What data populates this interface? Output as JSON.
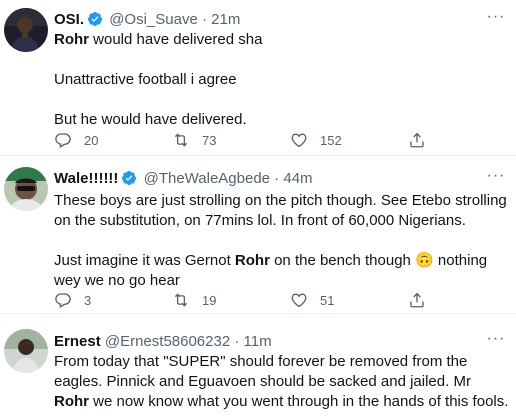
{
  "tweets": [
    {
      "name": "OSI.",
      "handle": "@Osi_Suave",
      "dot": "·",
      "time": "21m",
      "lines": [
        {
          "bold": "Rohr",
          "text": " would have delivered sha"
        },
        {
          "text": ""
        },
        {
          "text": "Unattractive football i agree"
        },
        {
          "text": ""
        },
        {
          "text": "But he would have delivered."
        }
      ],
      "replies": "20",
      "retweets": "73",
      "likes": "152"
    },
    {
      "name": "Wale!!!!!!",
      "handle": "@TheWaleAgbede",
      "dot": "·",
      "time": "44m",
      "para1": "These boys are just strolling on the pitch though. See Etebo strolling on the substitution, on 77mins lol. In front of 60,000 Nigerians.",
      "para2_a": "Just imagine it was Gernot ",
      "para2_bold": "Rohr",
      "para2_b": " on the bench though",
      "emoji": "🙃",
      "para2_c": " nothing wey we no go hear",
      "replies": "3",
      "retweets": "19",
      "likes": "51"
    },
    {
      "name": "Ernest",
      "handle": "@Ernest58606232",
      "dot": "·",
      "time": "11m",
      "text_a": "From today that \"SUPER\" should forever be removed from the eagles. Pinnick and Eguavoen should be sacked and jailed. Mr ",
      "text_bold": "Rohr",
      "text_b": " we now know what you went through in the hands of this fools."
    }
  ],
  "more_label": "···",
  "colors": {
    "verified": "#1d9bf0",
    "secondary": "#536471"
  },
  "icons": [
    "reply-icon",
    "retweet-icon",
    "like-icon",
    "share-icon",
    "verified-badge-icon",
    "more-icon"
  ]
}
